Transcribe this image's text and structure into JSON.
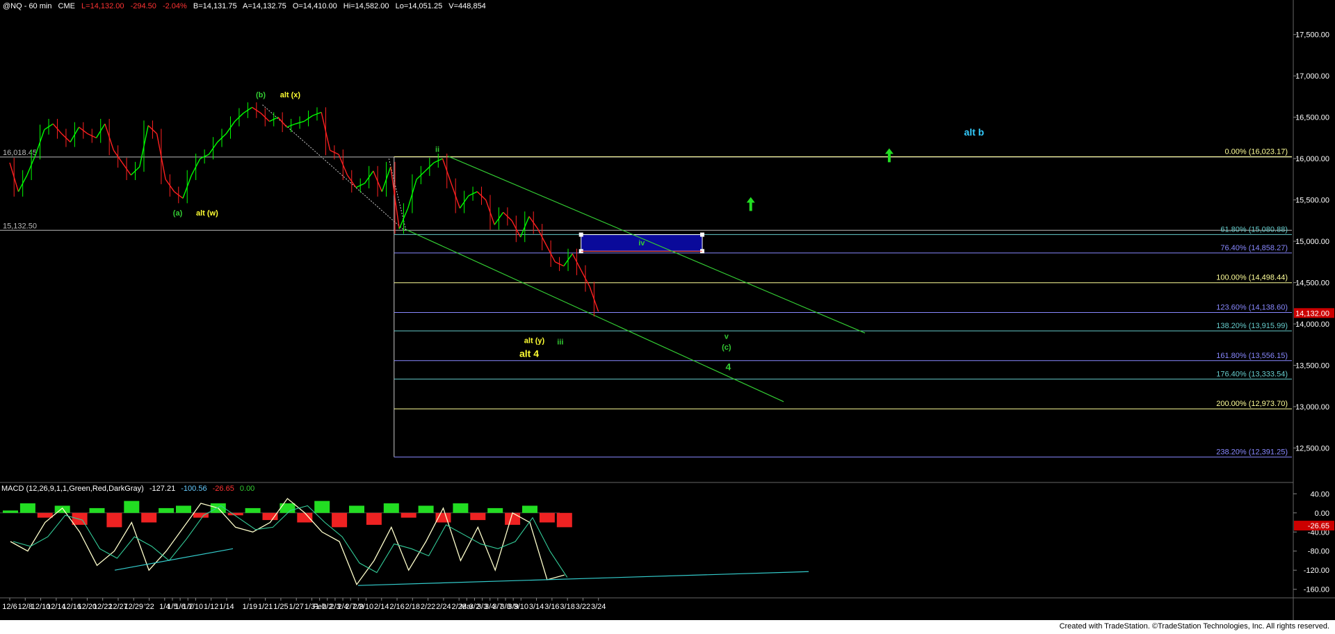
{
  "header": {
    "symbol": "@NQ - 60 min",
    "exchange": "CME",
    "last": "L=14,132.00",
    "change": "-294.50",
    "pct": "-2.04%",
    "bid": "B=14,131.75",
    "ask": "A=14,132.75",
    "open": "O=14,410.00",
    "high": "Hi=14,582.00",
    "low": "Lo=14,051.25",
    "volume": "V=448,854"
  },
  "colors": {
    "background": "#000000",
    "price_up": "#00ff00",
    "price_down": "#ff2020",
    "label_green": "#33cc33",
    "label_yellow": "#ffff33",
    "label_cyan": "#33ccff",
    "fib_yellow": "#ffff99",
    "fib_blue": "#8888ff",
    "fib_teal": "#66cccc",
    "box_fill": "#0a0a9a"
  },
  "chart_data": [
    {
      "type": "line",
      "title": "@NQ - 60 min",
      "y_axis_side": "right",
      "ylim": [
        12100,
        17800
      ],
      "y_ticks": [
        "17,500.00",
        "17,000.00",
        "16,500.00",
        "16,000.00",
        "15,500.00",
        "15,000.00",
        "14,500.00",
        "14,000.00",
        "13,500.00",
        "13,000.00",
        "12,500.00"
      ],
      "y_tick_values": [
        17500,
        17000,
        16500,
        16000,
        15500,
        15000,
        14500,
        14000,
        13500,
        13000,
        12500
      ],
      "x_ticks": [
        "12/6",
        "12/8",
        "12/10",
        "12/14",
        "12/16",
        "12/20",
        "12/22",
        "12/27",
        "12/29",
        "'22",
        "1/4",
        "1/5",
        "1/6",
        "1/7",
        "1/10",
        "1/12",
        "1/14",
        "1/19",
        "1/21",
        "1/25",
        "1/27",
        "1/31",
        "Feb",
        "2/2",
        "2/3",
        "2/4",
        "2/7",
        "2/9",
        "2/10",
        "2/14",
        "2/16",
        "2/18",
        "2/22",
        "2/24",
        "2/28",
        "Mar",
        "3/2",
        "3/3",
        "3/4",
        "3/7",
        "3/8",
        "3/9",
        "3/10",
        "3/14",
        "3/16",
        "3/18",
        "3/22",
        "3/24"
      ],
      "x_tick_index": [
        0,
        2,
        4,
        6,
        8,
        10,
        12,
        14,
        16,
        18,
        20,
        21,
        22,
        23,
        24,
        26,
        28,
        31,
        33,
        35,
        37,
        39,
        40,
        41,
        42,
        43,
        44,
        45,
        46,
        48,
        50,
        52,
        54,
        56,
        58,
        59,
        60,
        61,
        62,
        63,
        64,
        65,
        66,
        68,
        70,
        72,
        74,
        76
      ],
      "series": [
        {
          "x": [
            0,
            0.5,
            1,
            1.5,
            2,
            2.5,
            3,
            3.5,
            4,
            4.5,
            5,
            5.5,
            6,
            6.5,
            7,
            7.5,
            8,
            8.5,
            9,
            9.5,
            10,
            10.5,
            11,
            11.5,
            12,
            12.5,
            13,
            13.5,
            14,
            14.5,
            15,
            15.5,
            16,
            16.5,
            17,
            17.5,
            18,
            18.5,
            19,
            19.5,
            20,
            20.5,
            21,
            21.5,
            22,
            22.5,
            23,
            23.5,
            24,
            24.5,
            25,
            25.5,
            26,
            26.5,
            27,
            27.5,
            28,
            28.5,
            29,
            29.5,
            30,
            30.5,
            31,
            31.5,
            32,
            32.5,
            33,
            33.5,
            34
          ],
          "values": [
            15950,
            15600,
            15800,
            16050,
            16350,
            16420,
            16300,
            16200,
            16380,
            16300,
            16250,
            16420,
            16100,
            15950,
            15800,
            15900,
            16400,
            16300,
            15750,
            15600,
            15520,
            15800,
            16000,
            16050,
            16200,
            16300,
            16450,
            16550,
            16620,
            16550,
            16450,
            16500,
            16380,
            16420,
            16450,
            16520,
            16560,
            16100,
            16050,
            15800,
            15650,
            15700,
            15850,
            15600,
            15900,
            15150,
            15400,
            15750,
            15850,
            15950,
            16000,
            15700,
            15400,
            15550,
            15600,
            15500,
            15200,
            15350,
            15250,
            15050,
            15300,
            15150,
            14950,
            14750,
            14700,
            14850,
            14650,
            14450,
            14150
          ]
        }
      ],
      "fib_levels": [
        {
          "label": "0.00% (16,023.17)",
          "value": 16023.17
        },
        {
          "label": "61.80% (15,080.88)",
          "value": 15080.88
        },
        {
          "label": "76.40% (14,858.27)",
          "value": 14858.27
        },
        {
          "label": "100.00% (14,498.44)",
          "value": 14498.44
        },
        {
          "label": "123.60% (14,138.60)",
          "value": 14138.6
        },
        {
          "label": "138.20% (13,915.99)",
          "value": 13915.99
        },
        {
          "label": "161.80% (13,556.15)",
          "value": 13556.15
        },
        {
          "label": "176.40% (13,333.54)",
          "value": 13333.54
        },
        {
          "label": "200.00% (12,973.70)",
          "value": 12973.7
        },
        {
          "label": "238.20% (12,391.25)",
          "value": 12391.25
        }
      ],
      "level_lines": [
        {
          "label": "16,018.45",
          "value": 16018.45
        },
        {
          "label": "15,132.50",
          "value": 15132.5
        }
      ],
      "last_price_tag": "14,132.00",
      "annotations": [
        {
          "text": "(b)",
          "x": 14.5,
          "y": 16740,
          "color": "green"
        },
        {
          "text": "alt (x)",
          "x": 16.2,
          "y": 16740,
          "color": "yellow"
        },
        {
          "text": "(a)",
          "x": 9.7,
          "y": 15310,
          "color": "green"
        },
        {
          "text": "alt (w)",
          "x": 11.4,
          "y": 15310,
          "color": "yellow"
        },
        {
          "text": "ii",
          "x": 24.7,
          "y": 16080,
          "color": "green"
        },
        {
          "text": "iv",
          "x": 36.5,
          "y": 14950,
          "color": "green"
        },
        {
          "text": "alt (y)",
          "x": 30.3,
          "y": 13770,
          "color": "yellow"
        },
        {
          "text": "alt 4",
          "x": 30.0,
          "y": 13600,
          "color": "yellow",
          "large": true
        },
        {
          "text": "iii",
          "x": 31.8,
          "y": 13750,
          "color": "green"
        },
        {
          "text": "v",
          "x": 41.4,
          "y": 13820,
          "color": "green"
        },
        {
          "text": "(c)",
          "x": 41.4,
          "y": 13690,
          "color": "green"
        },
        {
          "text": "4",
          "x": 41.5,
          "y": 13440,
          "color": "green",
          "large": true
        },
        {
          "text": "alt b",
          "x": 55.7,
          "y": 16280,
          "color": "cyan",
          "large": true
        }
      ],
      "target_box": {
        "x_start": 33.0,
        "x_end": 40.0,
        "y_low": 14880,
        "y_high": 15080
      },
      "arrows": [
        {
          "x": 42.8,
          "y": 15450
        },
        {
          "x": 50.8,
          "y": 16040
        }
      ]
    },
    {
      "type": "bar",
      "title": "MACD (12,26,9,1,1,Green,Red,DarkGray)",
      "values_readout": [
        "-127.21",
        "-100.56",
        "-26.65",
        "0.00"
      ],
      "ylim": [
        -175,
        55
      ],
      "y_ticks": [
        "40.00",
        "0.00",
        "-40.00",
        "-80.00",
        "-120.00",
        "-160.00"
      ],
      "y_tick_values": [
        40,
        0,
        -40,
        -80,
        -120,
        -160
      ],
      "last_tag": "-26.65",
      "macd_x": [
        0,
        1,
        2,
        3,
        4,
        5,
        6,
        7,
        8,
        9,
        10,
        11,
        12,
        13,
        14,
        15,
        16,
        17,
        18,
        19,
        20,
        21,
        22,
        23,
        24,
        25,
        26,
        27,
        28,
        29,
        30,
        31,
        32
      ],
      "macd_values": [
        -60,
        -80,
        -20,
        10,
        -40,
        -110,
        -80,
        -20,
        -120,
        -80,
        -30,
        20,
        10,
        -30,
        -40,
        -20,
        30,
        0,
        -40,
        -60,
        -150,
        -100,
        -30,
        -120,
        -60,
        10,
        -100,
        -30,
        -120,
        0,
        -20,
        -140,
        -130
      ],
      "histogram": [
        5,
        20,
        -10,
        15,
        -25,
        10,
        -30,
        25,
        -20,
        10,
        15,
        -10,
        20,
        -5,
        10,
        -15,
        20,
        -20,
        25,
        -30,
        15,
        -25,
        20,
        -10,
        15,
        -20,
        20,
        -15,
        10,
        -25,
        15,
        -20,
        -30
      ]
    }
  ],
  "footer": {
    "credit": "Created with TradeStation. ©TradeStation Technologies, Inc. All rights reserved."
  }
}
